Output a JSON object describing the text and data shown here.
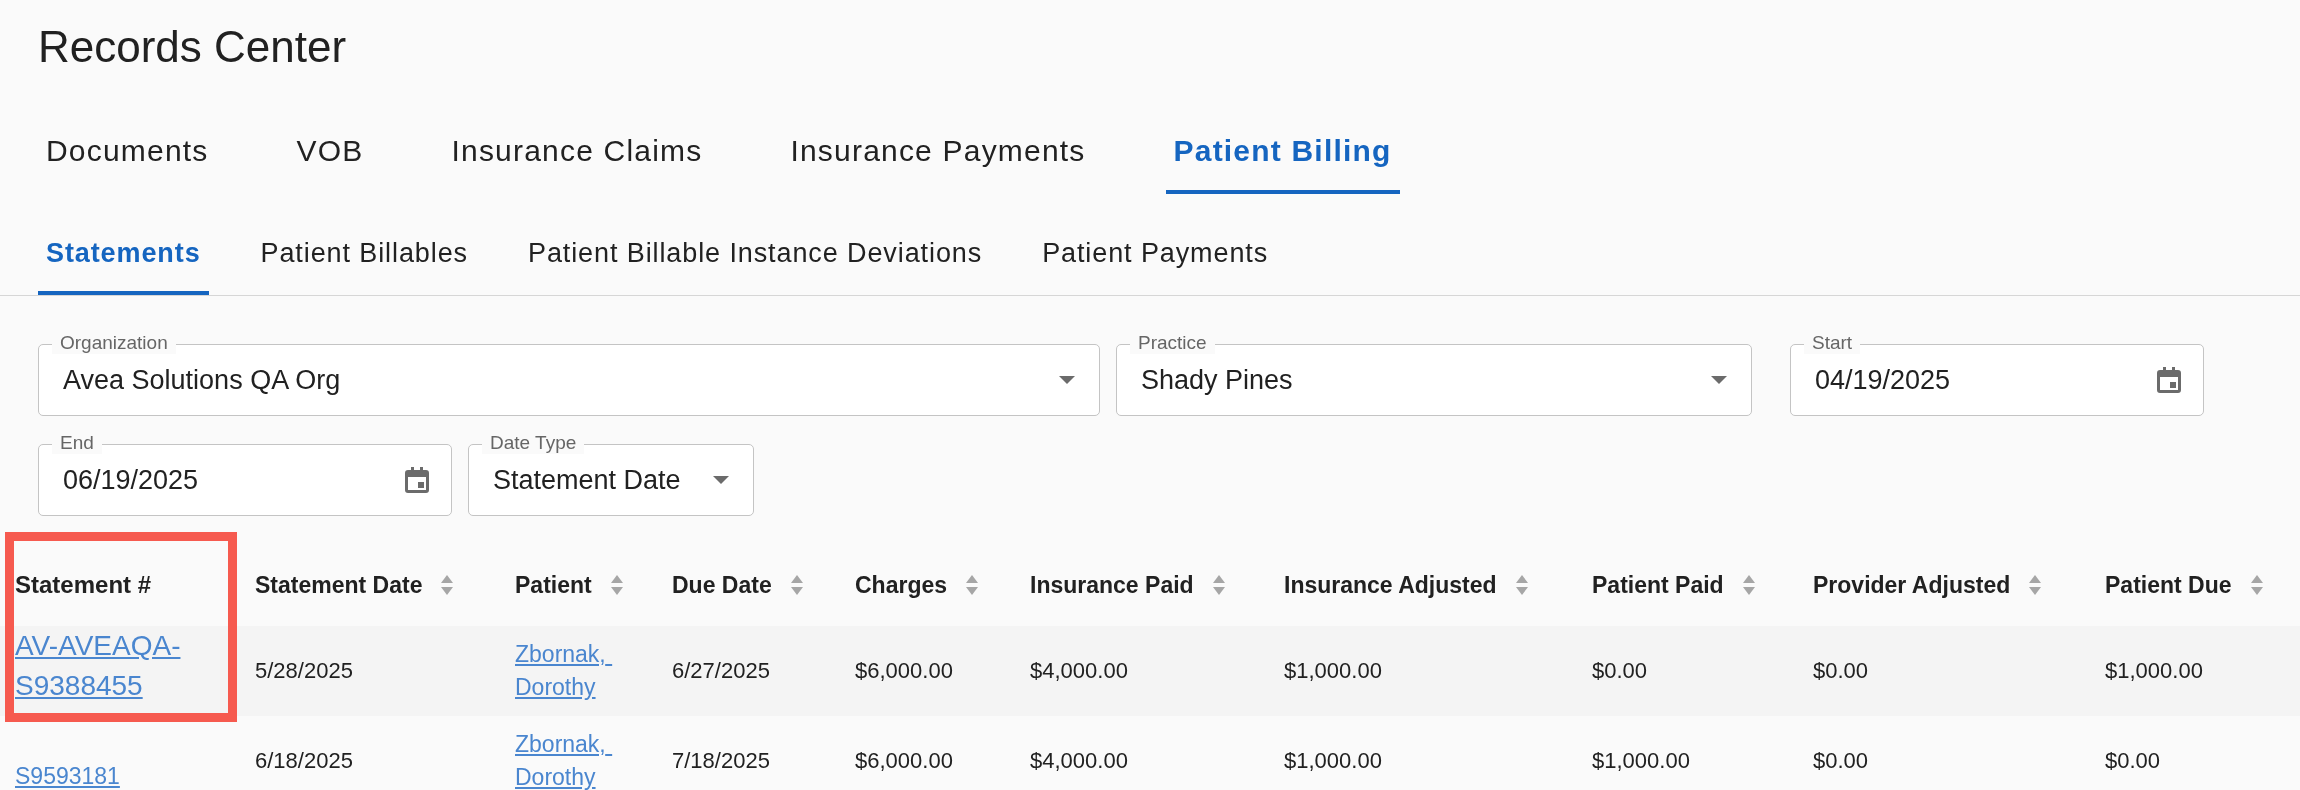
{
  "page_title": "Records Center",
  "tabs": [
    {
      "label": "Documents",
      "selected": false
    },
    {
      "label": "VOB",
      "selected": false
    },
    {
      "label": "Insurance Claims",
      "selected": false
    },
    {
      "label": "Insurance Payments",
      "selected": false
    },
    {
      "label": "Patient Billing",
      "selected": true
    }
  ],
  "subtabs": [
    {
      "label": "Statements",
      "selected": true
    },
    {
      "label": "Patient Billables",
      "selected": false
    },
    {
      "label": "Patient Billable Instance Deviations",
      "selected": false
    },
    {
      "label": "Patient Payments",
      "selected": false
    }
  ],
  "filters": [
    {
      "label": "Organization",
      "value": "Avea Solutions QA Org",
      "kind": "select"
    },
    {
      "label": "Practice",
      "value": "Shady Pines",
      "kind": "select"
    },
    {
      "label": "Start",
      "value": "04/19/2025",
      "kind": "date"
    },
    {
      "label": "End",
      "value": "06/19/2025",
      "kind": "date"
    },
    {
      "label": "Date Type",
      "value": "Statement Date",
      "kind": "select"
    }
  ],
  "table": {
    "columns": [
      {
        "label": "Statement #"
      },
      {
        "label": "Statement Date"
      },
      {
        "label": "Patient"
      },
      {
        "label": "Due Date"
      },
      {
        "label": "Charges"
      },
      {
        "label": "Insurance Paid"
      },
      {
        "label": "Insurance Adjusted"
      },
      {
        "label": "Patient Paid"
      },
      {
        "label": "Provider Adjusted"
      },
      {
        "label": "Patient Due"
      }
    ],
    "rows": [
      {
        "statement": "AV-AVEAQA-S9388455",
        "statement_date": "5/28/2025",
        "patient": "Zbornak, Dorothy",
        "due_date": "6/27/2025",
        "charges": "$6,000.00",
        "insurance_paid": "$4,000.00",
        "insurance_adjusted": "$1,000.00",
        "patient_paid": "$0.00",
        "provider_adjusted": "$0.00",
        "patient_due": "$1,000.00"
      },
      {
        "statement": "S9593181",
        "statement_date": "6/18/2025",
        "patient": "Zbornak, Dorothy",
        "due_date": "7/18/2025",
        "charges": "$6,000.00",
        "insurance_paid": "$4,000.00",
        "insurance_adjusted": "$1,000.00",
        "patient_paid": "$1,000.00",
        "provider_adjusted": "$0.00",
        "patient_due": "$0.00"
      }
    ]
  }
}
